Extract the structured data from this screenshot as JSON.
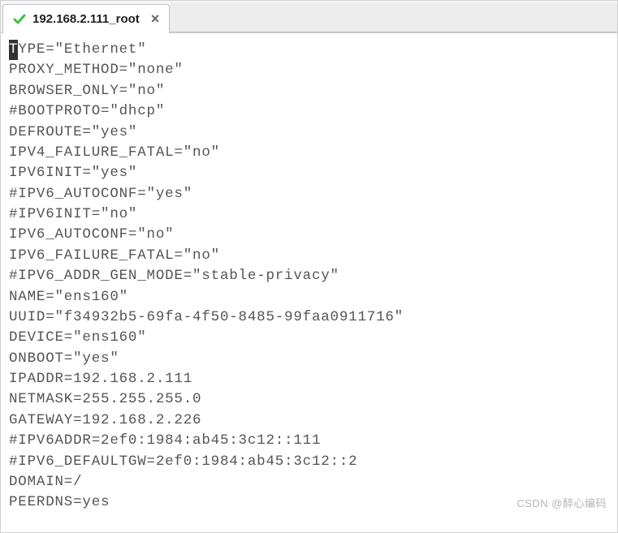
{
  "tab": {
    "title": "192.168.2.111_root",
    "close_glyph": "×"
  },
  "cursor_first_char": "T",
  "lines_rest": [
    "YPE=\"Ethernet\"",
    "PROXY_METHOD=\"none\"",
    "BROWSER_ONLY=\"no\"",
    "#BOOTPROTO=\"dhcp\"",
    "DEFROUTE=\"yes\"",
    "IPV4_FAILURE_FATAL=\"no\"",
    "IPV6INIT=\"yes\"",
    "#IPV6_AUTOCONF=\"yes\"",
    "#IPV6INIT=\"no\"",
    "IPV6_AUTOCONF=\"no\"",
    "IPV6_FAILURE_FATAL=\"no\"",
    "#IPV6_ADDR_GEN_MODE=\"stable-privacy\"",
    "NAME=\"ens160\"",
    "UUID=\"f34932b5-69fa-4f50-8485-99faa0911716\"",
    "DEVICE=\"ens160\"",
    "ONBOOT=\"yes\"",
    "IPADDR=192.168.2.111",
    "NETMASK=255.255.255.0",
    "GATEWAY=192.168.2.226",
    "#IPV6ADDR=2ef0:1984:ab45:3c12::111",
    "#IPV6_DEFAULTGW=2ef0:1984:ab45:3c12::2",
    "DOMAIN=/",
    "PEERDNS=yes"
  ],
  "watermark": "CSDN @醉心编码"
}
